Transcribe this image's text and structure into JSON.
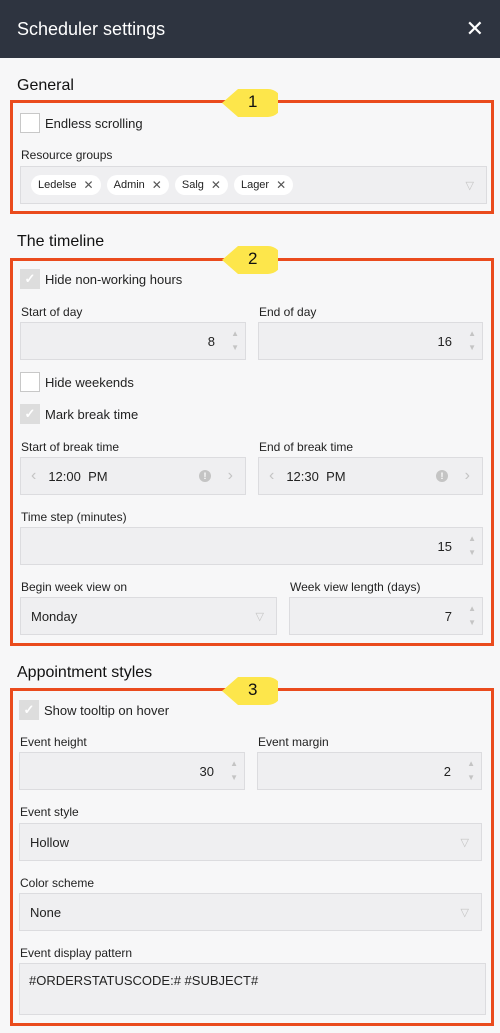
{
  "header": {
    "title": "Scheduler settings",
    "close_icon": "close-icon"
  },
  "sections": {
    "general": "General",
    "timeline": "The timeline",
    "appointment": "Appointment styles"
  },
  "badges": {
    "b1": "1",
    "b2": "2",
    "b3": "3",
    "color": "#fde64b",
    "border": "#ea4b1d"
  },
  "general": {
    "endless_scrolling": {
      "label": "Endless scrolling",
      "checked": false
    },
    "resource_groups_label": "Resource groups",
    "resource_groups": [
      "Ledelse",
      "Admin",
      "Salg",
      "Lager"
    ]
  },
  "timeline": {
    "hide_nonworking": {
      "label": "Hide non-working hours",
      "checked": true
    },
    "start_of_day_label": "Start of day",
    "start_of_day": "8",
    "end_of_day_label": "End of day",
    "end_of_day": "16",
    "hide_weekends": {
      "label": "Hide weekends",
      "checked": false
    },
    "mark_break": {
      "label": "Mark break time",
      "checked": true
    },
    "start_break_label": "Start of break time",
    "start_break": "12:00  PM",
    "end_break_label": "End of break time",
    "end_break": "12:30  PM",
    "time_step_label": "Time step (minutes)",
    "time_step": "15",
    "begin_week_label": "Begin week view on",
    "begin_week": "Monday",
    "week_length_label": "Week view length (days)",
    "week_length": "7"
  },
  "appointment": {
    "show_tooltip": {
      "label": "Show tooltip on hover",
      "checked": true
    },
    "event_height_label": "Event height",
    "event_height": "30",
    "event_margin_label": "Event margin",
    "event_margin": "2",
    "event_style_label": "Event style",
    "event_style": "Hollow",
    "color_scheme_label": "Color scheme",
    "color_scheme": "None",
    "display_pattern_label": "Event display pattern",
    "display_pattern": "#ORDERSTATUSCODE:# #SUBJECT#"
  }
}
